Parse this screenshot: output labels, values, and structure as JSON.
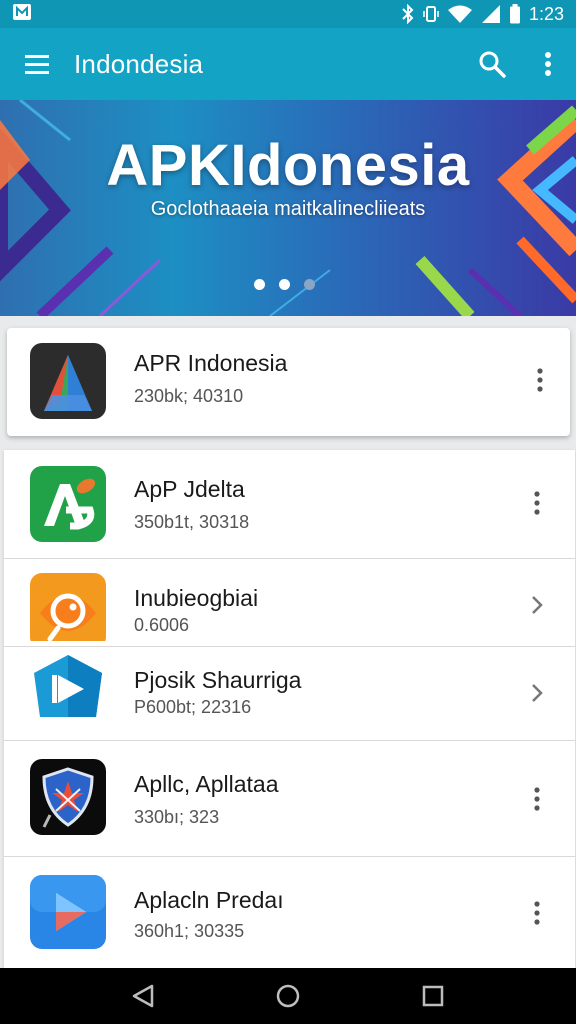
{
  "status_bar": {
    "time": "1:23",
    "icons": [
      "notification-icon",
      "bluetooth-icon",
      "vibrate-icon",
      "wifi-icon",
      "signal-icon",
      "battery-icon"
    ]
  },
  "app_bar": {
    "title": "Indondesia",
    "icons": [
      "hamburger-menu-icon",
      "search-icon",
      "overflow-menu-icon"
    ],
    "color": "#13a3c4"
  },
  "banner": {
    "title": "APKIdonesia",
    "subtitle": "Goclothaaeia maitkalinecliieats",
    "carousel": {
      "count": 3,
      "active": 0
    }
  },
  "featured": {
    "title": "APR Indonesia",
    "subtitle": "230bk; 40310",
    "icon": "android-studio-like-icon",
    "action_icon": "overflow-menu-icon"
  },
  "apps": [
    {
      "title": "ApP Jdelta",
      "subtitle": "350b1t, 30318",
      "icon": "green-a-logo-icon",
      "action_icon": "overflow-menu-icon"
    },
    {
      "title": "Inubieogbiai",
      "subtitle": "0.6006",
      "icon": "orange-fish-icon",
      "action_icon": "chevron-right-icon"
    },
    {
      "title": "Pjosik Shaurriga",
      "subtitle": "P600bt; 22316",
      "icon": "blue-play-hexagon-icon",
      "action_icon": "chevron-right-icon"
    },
    {
      "title": "Apllc, Apllataa",
      "subtitle": "330bı; 323",
      "icon": "shield-star-icon",
      "action_icon": "overflow-menu-icon"
    },
    {
      "title": "Aplacln Predaı",
      "subtitle": "360h1; 30335",
      "icon": "blue-play-icon",
      "action_icon": "overflow-menu-icon"
    }
  ],
  "nav_bar": {
    "icons": [
      "back-icon",
      "home-icon",
      "recents-icon"
    ]
  }
}
